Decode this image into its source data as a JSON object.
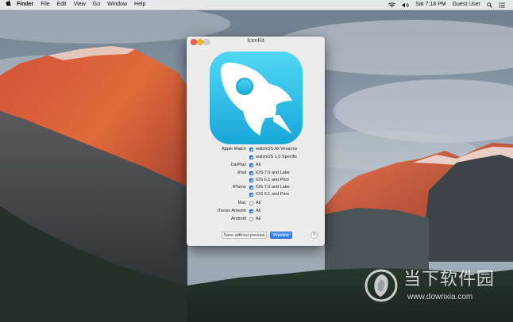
{
  "menubar": {
    "apple_icon": "apple-logo-icon",
    "items": [
      "Finder",
      "File",
      "Edit",
      "View",
      "Go",
      "Window",
      "Help"
    ],
    "status": {
      "wifi_icon": "wifi-icon",
      "volume_icon": "volume-icon",
      "clock": "Sat 7:18 PM",
      "user": "Guest User",
      "search_icon": "spotlight-search-icon",
      "list_icon": "notification-center-icon"
    }
  },
  "window": {
    "title": "IconKit",
    "app_icon": "rocket-icon",
    "options": [
      {
        "platform": "Apple Watch",
        "option": "watchOS All Versions",
        "checked": true
      },
      {
        "platform": "",
        "option": "watchOS 1.0 Specific",
        "checked": true
      },
      {
        "platform": "CarPlay",
        "option": "All",
        "checked": true
      },
      {
        "platform": "iPad",
        "option": "iOS 7.0 and Later",
        "checked": true
      },
      {
        "platform": "",
        "option": "iOS 6.1 and Prior",
        "checked": true
      },
      {
        "platform": "iPhone",
        "option": "iOS 7.0 and Later",
        "checked": true
      },
      {
        "platform": "",
        "option": "iOS 6.1 and Prior",
        "checked": true
      },
      {
        "platform": "Mac",
        "option": "All",
        "checked": false
      },
      {
        "platform": "iTunes Artwork",
        "option": "All",
        "checked": true
      },
      {
        "platform": "Android",
        "option": "All",
        "checked": false
      }
    ],
    "buttons": {
      "save_without_preview": "Save without preview",
      "preview": "Preview",
      "help": "?"
    },
    "colors": {
      "accent": "#2c74e7",
      "icon_gradient_top": "#4fd6f3",
      "icon_gradient_bottom": "#1aa8dc"
    }
  },
  "watermark": {
    "title": "当下软件园",
    "url": "www.downxia.com"
  }
}
